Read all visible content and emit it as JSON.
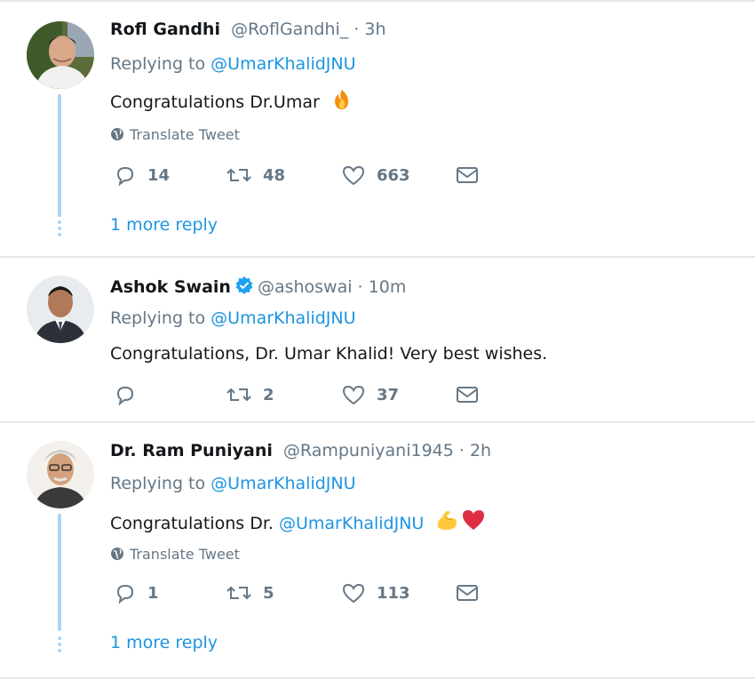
{
  "tweets": [
    {
      "name": "Rofl Gandhi",
      "handle": "@RoflGandhi_ · 3h",
      "replying_prefix": "Replying to ",
      "replying_to": "@UmarKhalidJNU",
      "text": "Congratulations Dr.Umar",
      "emoji": "fire-emoji",
      "translate": "Translate Tweet",
      "replies": "14",
      "retweets": "48",
      "likes": "663",
      "more_reply": "1 more reply"
    },
    {
      "name": "Ashok Swain",
      "handle": "@ashoswai · 10m",
      "verified": true,
      "replying_prefix": "Replying to ",
      "replying_to": "@UmarKhalidJNU",
      "text": "Congratulations, Dr. Umar Khalid! Very best wishes.",
      "replies": "",
      "retweets": "2",
      "likes": "37"
    },
    {
      "name": "Dr. Ram Puniyani",
      "handle": "@Rampuniyani1945 · 2h",
      "replying_prefix": "Replying to ",
      "replying_to": "@UmarKhalidJNU",
      "text_prefix": "Congratulations Dr. ",
      "text_mention": "@UmarKhalidJNU",
      "emoji": "flexed-biceps-emoji heart-emoji",
      "translate": "Translate Tweet",
      "replies": "1",
      "retweets": "5",
      "likes": "113",
      "more_reply": "1 more reply"
    }
  ],
  "colors": {
    "link": "#1b95e0",
    "secondary_text": "#657786",
    "thread_line": "#aad4f5",
    "separator": "#e1e8ed"
  }
}
